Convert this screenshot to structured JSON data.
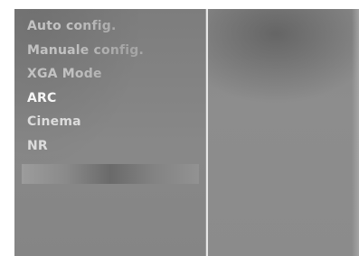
{
  "menu": {
    "items": [
      {
        "label": "Auto config."
      },
      {
        "label": "Manuale config."
      },
      {
        "label": "XGA Mode"
      },
      {
        "label": "ARC"
      },
      {
        "label": "Cinema"
      },
      {
        "label": "NR"
      }
    ]
  },
  "colors": {
    "menu_background": "#858585",
    "selection_bar": "#6a6a6a",
    "preview_background": "#8b8b8b"
  }
}
